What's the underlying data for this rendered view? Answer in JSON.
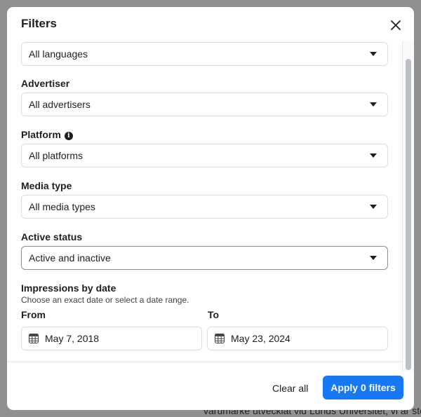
{
  "background": {
    "snippet": "varumärke utvecklat vid Lunds Universitet, vi är stolta"
  },
  "dialog": {
    "title": "Filters",
    "language": {
      "value": "All languages"
    },
    "advertiser": {
      "label": "Advertiser",
      "value": "All advertisers"
    },
    "platform": {
      "label": "Platform",
      "value": "All platforms",
      "info_icon": "i"
    },
    "media_type": {
      "label": "Media type",
      "value": "All media types"
    },
    "active_status": {
      "label": "Active status",
      "value": "Active and inactive"
    },
    "impressions": {
      "label": "Impressions by date",
      "hint": "Choose an exact date or select a date range.",
      "from_label": "From",
      "from_value": "May 7, 2018",
      "to_label": "To",
      "to_value": "May 23, 2024"
    },
    "footer": {
      "clear_label": "Clear all",
      "apply_label": "Apply 0 filters"
    }
  },
  "colors": {
    "accent": "#1877f2"
  }
}
